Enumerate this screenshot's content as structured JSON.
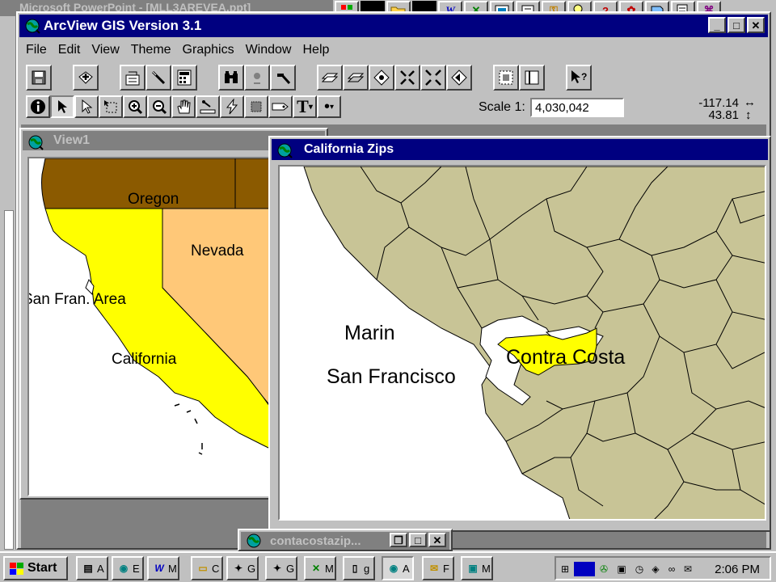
{
  "background_window": {
    "title": "Microsoft PowerPoint - [MLL3AREVEA.ppt]"
  },
  "arcview": {
    "title": "ArcView GIS Version 3.1",
    "menu": [
      {
        "label": "File"
      },
      {
        "label": "Edit"
      },
      {
        "label": "View"
      },
      {
        "label": "Theme"
      },
      {
        "label": "Graphics"
      },
      {
        "label": "Window"
      },
      {
        "label": "Help"
      }
    ],
    "scale_label": "Scale 1:",
    "scale_value": "4,030,042",
    "coord_x": "-117.14",
    "coord_y": "43.81"
  },
  "view1": {
    "title": "View1",
    "labels": {
      "oregon": "Oregon",
      "nevada": "Nevada",
      "sf_area": "San Fran. Area",
      "california": "California"
    },
    "colors": {
      "oregon": "#8b5a00",
      "nevada": "#ffc878",
      "california": "#ffff00"
    }
  },
  "zips": {
    "title": "California Zips",
    "labels": {
      "marin": "Marin",
      "san_francisco": "San Francisco",
      "contra_costa": "Contra Costa"
    },
    "colors": {
      "land": "#c8c496",
      "highlight": "#ffff00"
    }
  },
  "minimized": {
    "title": "contacostazip..."
  },
  "taskbar": {
    "start": "Start",
    "buttons": [
      {
        "icon": "notepad-icon",
        "label": "A"
      },
      {
        "icon": "arcview-icon",
        "label": "E"
      },
      {
        "icon": "word-icon",
        "label": "M"
      },
      {
        "icon": "folder-icon",
        "label": "C"
      },
      {
        "icon": "program-icon",
        "label": "G"
      },
      {
        "icon": "program-icon",
        "label": "G"
      },
      {
        "icon": "excel-icon",
        "label": "M"
      },
      {
        "icon": "document-icon",
        "label": "g"
      },
      {
        "icon": "arcview-icon",
        "label": "A"
      },
      {
        "icon": "mail-icon",
        "label": "F"
      },
      {
        "icon": "monitor-icon",
        "label": "M"
      }
    ],
    "clock": "2:06 PM"
  }
}
